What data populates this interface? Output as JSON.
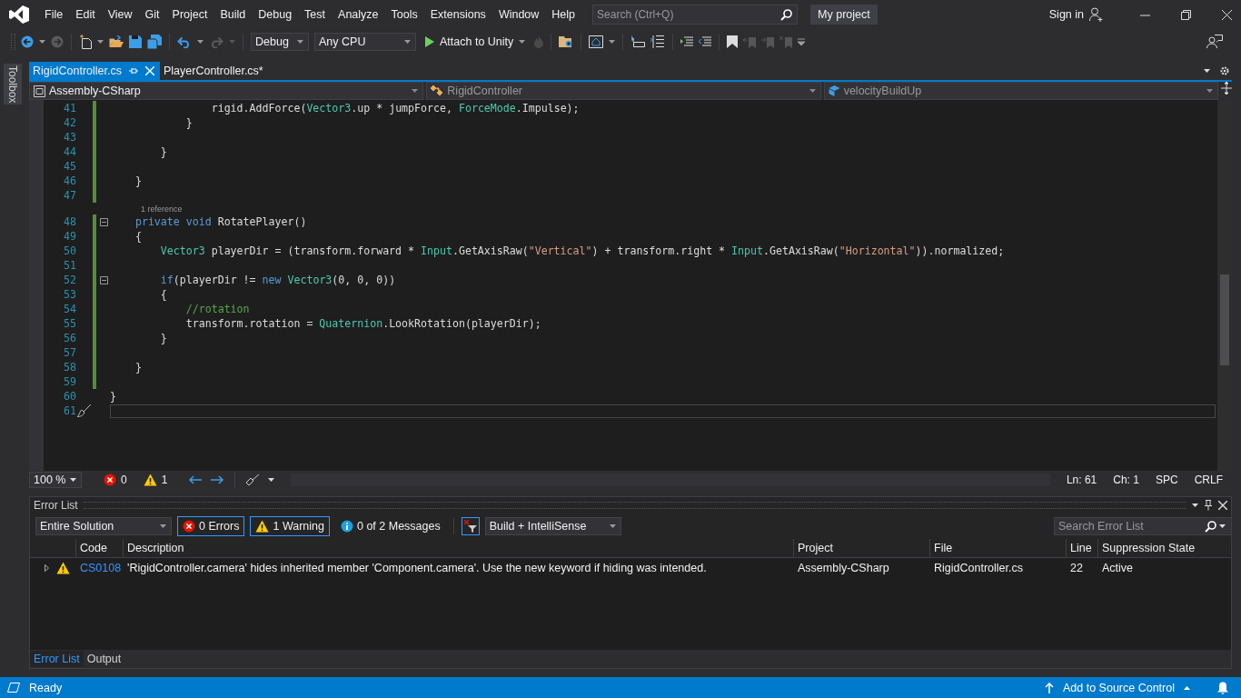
{
  "menu": [
    "File",
    "Edit",
    "View",
    "Git",
    "Project",
    "Build",
    "Debug",
    "Test",
    "Analyze",
    "Tools",
    "Extensions",
    "Window",
    "Help"
  ],
  "search": {
    "placeholder": "Search (Ctrl+Q)"
  },
  "project_name": "My project",
  "sign_in": "Sign in",
  "toolbar": {
    "configuration": "Debug",
    "platform": "Any CPU",
    "run": "Attach to Unity"
  },
  "toolbox": "Toolbox",
  "tabs": [
    {
      "label": "RigidController.cs",
      "selected": true
    },
    {
      "label": "PlayerController.cs*",
      "selected": false
    }
  ],
  "navigation": [
    "Assembly-CSharp",
    "RigidController",
    "velocityBuildUp"
  ],
  "code": {
    "lines": [
      {
        "number": "41",
        "changed": true,
        "current": false,
        "collapsible": false,
        "tokens": [
          {
            "kind": "plain",
            "text": "                rigid.AddForce("
          },
          {
            "kind": "type",
            "text": "Vector3"
          },
          {
            "kind": "plain",
            "text": ".up * jumpForce, "
          },
          {
            "kind": "type",
            "text": "ForceMode"
          },
          {
            "kind": "plain",
            "text": ".Impulse);"
          }
        ]
      },
      {
        "number": "42",
        "changed": true,
        "current": false,
        "collapsible": false,
        "tokens": [
          {
            "kind": "plain",
            "text": "            }"
          }
        ]
      },
      {
        "number": "43",
        "changed": true,
        "current": false,
        "collapsible": false
      },
      {
        "number": "44",
        "changed": true,
        "current": false,
        "collapsible": false,
        "tokens": [
          {
            "kind": "plain",
            "text": "        }"
          }
        ]
      },
      {
        "number": "45",
        "changed": true,
        "current": false,
        "collapsible": false
      },
      {
        "number": "46",
        "changed": true,
        "current": false,
        "collapsible": false,
        "tokens": [
          {
            "kind": "plain",
            "text": "    }"
          }
        ]
      },
      {
        "number": "47",
        "changed": true,
        "current": false,
        "collapsible": false
      },
      {
        "number": "48",
        "changed": true,
        "current": false,
        "collapsible": true,
        "codelens": "1 reference",
        "tokens": [
          {
            "kind": "keyword",
            "text": "    private"
          },
          {
            "kind": "keyword",
            "text": " void"
          },
          {
            "kind": "plain",
            "text": " RotatePlayer()"
          }
        ]
      },
      {
        "number": "49",
        "changed": true,
        "current": false,
        "collapsible": false,
        "tokens": [
          {
            "kind": "plain",
            "text": "    {"
          }
        ]
      },
      {
        "number": "50",
        "changed": true,
        "current": false,
        "collapsible": false,
        "tokens": [
          {
            "kind": "type",
            "text": "        Vector3"
          },
          {
            "kind": "plain",
            "text": " playerDir = (transform.forward * "
          },
          {
            "kind": "type",
            "text": "Input"
          },
          {
            "kind": "plain",
            "text": ".GetAxisRaw("
          },
          {
            "kind": "string",
            "text": "\"Vertical\""
          },
          {
            "kind": "plain",
            "text": ") + transform.right * "
          },
          {
            "kind": "type",
            "text": "Input"
          },
          {
            "kind": "plain",
            "text": ".GetAxisRaw("
          },
          {
            "kind": "string",
            "text": "\"Horizontal\""
          },
          {
            "kind": "plain",
            "text": ")).normalized;"
          }
        ]
      },
      {
        "number": "51",
        "changed": true,
        "current": false,
        "collapsible": false
      },
      {
        "number": "52",
        "changed": true,
        "current": false,
        "collapsible": true,
        "tokens": [
          {
            "kind": "keyword",
            "text": "        if"
          },
          {
            "kind": "plain",
            "text": "(playerDir != "
          },
          {
            "kind": "keyword",
            "text": "new"
          },
          {
            "kind": "type",
            "text": " Vector3"
          },
          {
            "kind": "plain",
            "text": "(0, 0, 0))"
          }
        ]
      },
      {
        "number": "53",
        "changed": true,
        "current": false,
        "collapsible": false,
        "tokens": [
          {
            "kind": "plain",
            "text": "        {"
          }
        ]
      },
      {
        "number": "54",
        "changed": true,
        "current": false,
        "collapsible": false,
        "tokens": [
          {
            "kind": "comment",
            "text": "            //rotation"
          }
        ]
      },
      {
        "number": "55",
        "changed": true,
        "current": false,
        "collapsible": false,
        "tokens": [
          {
            "kind": "plain",
            "text": "            transform.rotation = "
          },
          {
            "kind": "type",
            "text": "Quaternion"
          },
          {
            "kind": "plain",
            "text": ".LookRotation(playerDir);"
          }
        ]
      },
      {
        "number": "56",
        "changed": true,
        "current": false,
        "collapsible": false,
        "tokens": [
          {
            "kind": "plain",
            "text": "        }"
          }
        ]
      },
      {
        "number": "57",
        "changed": true,
        "current": false,
        "collapsible": false
      },
      {
        "number": "58",
        "changed": true,
        "current": false,
        "collapsible": false,
        "tokens": [
          {
            "kind": "plain",
            "text": "    }"
          }
        ]
      },
      {
        "number": "59",
        "changed": true,
        "current": false,
        "collapsible": false
      },
      {
        "number": "60",
        "changed": false,
        "current": false,
        "collapsible": false,
        "tokens": [
          {
            "kind": "plain",
            "text": "}"
          }
        ]
      },
      {
        "number": "61",
        "changed": false,
        "current": true,
        "collapsible": false
      }
    ]
  },
  "editor_status": {
    "zoom": "100 %",
    "errors": "0",
    "warnings": "1",
    "line": "Ln: 61",
    "column": "Ch: 1",
    "spacing": "SPC",
    "line_ending": "CRLF"
  },
  "error_list": {
    "title": "Error List",
    "scope": "Entire Solution",
    "filters": [
      {
        "kind": "error",
        "label": "0 Errors",
        "selected": true
      },
      {
        "kind": "warning",
        "label": "1 Warning",
        "selected": true
      },
      {
        "kind": "info",
        "label": "0 of 2 Messages",
        "selected": false
      }
    ],
    "source": "Build + IntelliSense",
    "search": {
      "placeholder": "Search Error List"
    },
    "columns": [
      "Code",
      "Description",
      "Project",
      "File",
      "Line",
      "Suppression State"
    ],
    "rows": [
      {
        "kind": "warning",
        "code": "CS0108",
        "description": "'RigidController.camera' hides inherited member 'Component.camera'. Use the new keyword if hiding was intended.",
        "project": "Assembly-CSharp",
        "file": "RigidController.cs",
        "line": "22",
        "suppression": "Active"
      }
    ]
  },
  "bottom_tabs": [
    {
      "label": "Error List",
      "selected": true
    },
    {
      "label": "Output",
      "selected": false
    }
  ],
  "status_bar": {
    "state": "Ready",
    "source_control": "Add to Source Control"
  }
}
